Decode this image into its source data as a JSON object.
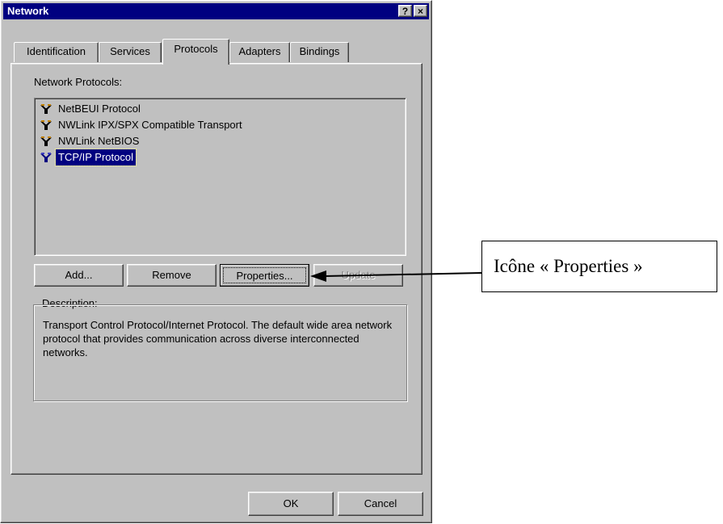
{
  "window": {
    "title": "Network",
    "help_glyph": "?",
    "close_glyph": "×"
  },
  "tabs": [
    {
      "label": "Identification",
      "active": false
    },
    {
      "label": "Services",
      "active": false
    },
    {
      "label": "Protocols",
      "active": true
    },
    {
      "label": "Adapters",
      "active": false
    },
    {
      "label": "Bindings",
      "active": false
    }
  ],
  "protocols": {
    "label": "Network Protocols:",
    "items": [
      {
        "label": "NetBEUI Protocol",
        "selected": false,
        "icon": "network-protocol-icon"
      },
      {
        "label": "NWLink IPX/SPX Compatible Transport",
        "selected": false,
        "icon": "network-protocol-icon"
      },
      {
        "label": "NWLink NetBIOS",
        "selected": false,
        "icon": "network-protocol-icon"
      },
      {
        "label": "TCP/IP Protocol",
        "selected": true,
        "icon": "network-protocol-icon"
      }
    ]
  },
  "buttons": {
    "add": "Add...",
    "remove": "Remove",
    "properties": "Properties...",
    "update": "Update",
    "ok": "OK",
    "cancel": "Cancel"
  },
  "description": {
    "title": "Description:",
    "text": "Transport Control Protocol/Internet Protocol. The default wide area network protocol that provides communication across diverse interconnected networks."
  },
  "callout": {
    "text": "Icône « Properties »"
  },
  "colors": {
    "titlebar": "#000080",
    "face": "#c0c0c0",
    "selection": "#000080"
  }
}
